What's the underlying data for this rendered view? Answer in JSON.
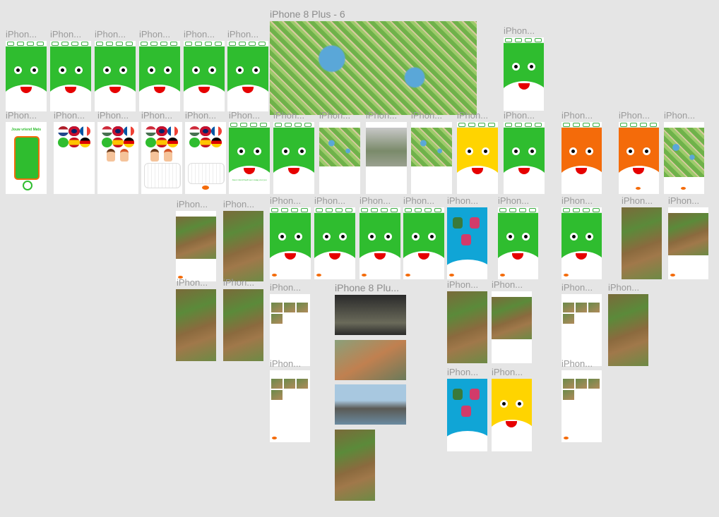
{
  "canvas": {
    "background": "#e5e5e5",
    "accent_green": "#2fbd2f",
    "accent_orange": "#f46b0a",
    "accent_yellow": "#ffd400",
    "accent_blue": "#10a5d6"
  },
  "labels": {
    "short": "iPhon...",
    "map_frame": "iPhone 8 Plus - 6",
    "photos_frame": "iPhone 8 Plu..."
  },
  "screens": {
    "welcome_title": "Jouw vriend Mats",
    "speech_start": "Jouw vriend heeft een vraag voor jou",
    "sticker_line": "Heb je een gift?"
  },
  "icons": [
    "home-icon",
    "map-icon",
    "camera-icon",
    "grass-icon",
    "footprint-icon",
    "flag-nl-icon",
    "flag-uk-icon",
    "flag-fr-icon",
    "flag-es-icon",
    "flag-de-icon",
    "flag-hu-icon"
  ]
}
